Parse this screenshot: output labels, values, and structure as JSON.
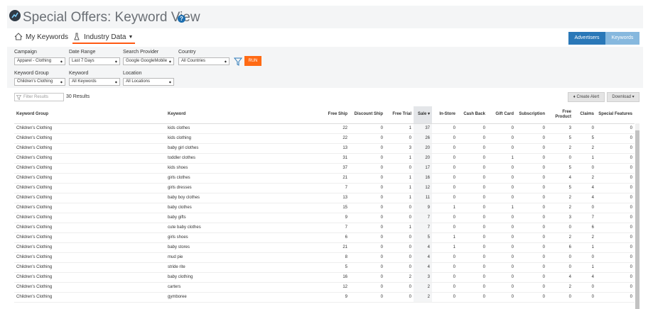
{
  "header": {
    "title": "Special Offers: Keyword View",
    "help": "?"
  },
  "nav": {
    "my_keywords": "My Keywords",
    "industry_data": "Industry Data"
  },
  "toggle": {
    "advertisers": "Advertisers",
    "keywords": "Keywords"
  },
  "colors": {
    "accent": "#ff6a14",
    "primary": "#2a78b8",
    "primary_light": "#86b8de",
    "help": "#1d6fb0"
  },
  "filters": {
    "campaign": {
      "label": "Campaign",
      "value": "Apparel - Clothing"
    },
    "date_range": {
      "label": "Date Range",
      "value": "Last 7 Days"
    },
    "search_provider": {
      "label": "Search Provider",
      "value": "Google GoogleMobile"
    },
    "country": {
      "label": "Country",
      "value": "All Countries"
    },
    "keyword_group": {
      "label": "Keyword Group",
      "value": "Children's Clothing"
    },
    "keyword": {
      "label": "Keyword",
      "value": "All Keywords"
    },
    "location": {
      "label": "Location",
      "value": "All Locations"
    },
    "run": "RUN"
  },
  "toolbar": {
    "filter_placeholder": "Filter Results",
    "results_count": "30 Results",
    "create_alert": "Create Alert",
    "download": "Download"
  },
  "table": {
    "columns": [
      "Keyword Group",
      "Keyword",
      "Free Ship",
      "Discount Ship",
      "Free Trial",
      "Sale",
      "In-Store",
      "Cash Back",
      "Gift Card",
      "Subscription",
      "Free Product",
      "Claims",
      "Special Features"
    ],
    "rows": [
      [
        "Children's Clothing",
        "kids clothes",
        "22",
        "0",
        "1",
        "37",
        "0",
        "0",
        "0",
        "0",
        "3",
        "0",
        "0"
      ],
      [
        "Children's Clothing",
        "kids clothing",
        "22",
        "0",
        "0",
        "26",
        "0",
        "0",
        "0",
        "0",
        "5",
        "5",
        "0"
      ],
      [
        "Children's Clothing",
        "baby girl clothes",
        "13",
        "0",
        "3",
        "20",
        "0",
        "0",
        "0",
        "0",
        "2",
        "2",
        "0"
      ],
      [
        "Children's Clothing",
        "toddler clothes",
        "31",
        "0",
        "1",
        "20",
        "0",
        "0",
        "1",
        "0",
        "0",
        "1",
        "0"
      ],
      [
        "Children's Clothing",
        "kids shoes",
        "37",
        "0",
        "0",
        "17",
        "0",
        "0",
        "0",
        "0",
        "5",
        "0",
        "0"
      ],
      [
        "Children's Clothing",
        "girls clothes",
        "21",
        "0",
        "1",
        "16",
        "0",
        "0",
        "0",
        "0",
        "4",
        "2",
        "0"
      ],
      [
        "Children's Clothing",
        "girls dresses",
        "7",
        "0",
        "1",
        "12",
        "0",
        "0",
        "0",
        "0",
        "5",
        "4",
        "0"
      ],
      [
        "Children's Clothing",
        "baby boy clothes",
        "13",
        "0",
        "1",
        "11",
        "0",
        "0",
        "0",
        "0",
        "2",
        "4",
        "0"
      ],
      [
        "Children's Clothing",
        "baby clothes",
        "15",
        "0",
        "0",
        "9",
        "1",
        "0",
        "1",
        "0",
        "2",
        "0",
        "0"
      ],
      [
        "Children's Clothing",
        "baby gifts",
        "9",
        "0",
        "0",
        "7",
        "0",
        "0",
        "0",
        "0",
        "3",
        "7",
        "0"
      ],
      [
        "Children's Clothing",
        "cute baby clothes",
        "7",
        "0",
        "1",
        "7",
        "0",
        "0",
        "0",
        "0",
        "0",
        "6",
        "0"
      ],
      [
        "Children's Clothing",
        "girls shoes",
        "6",
        "0",
        "0",
        "5",
        "1",
        "0",
        "0",
        "0",
        "2",
        "2",
        "0"
      ],
      [
        "Children's Clothing",
        "baby stores",
        "21",
        "0",
        "0",
        "4",
        "1",
        "0",
        "0",
        "0",
        "6",
        "1",
        "0"
      ],
      [
        "Children's Clothing",
        "mud pie",
        "8",
        "0",
        "0",
        "4",
        "0",
        "0",
        "0",
        "0",
        "0",
        "0",
        "0"
      ],
      [
        "Children's Clothing",
        "stride rite",
        "5",
        "0",
        "0",
        "4",
        "0",
        "0",
        "0",
        "0",
        "0",
        "1",
        "0"
      ],
      [
        "Children's Clothing",
        "baby clothing",
        "16",
        "0",
        "2",
        "3",
        "0",
        "0",
        "0",
        "0",
        "4",
        "4",
        "0"
      ],
      [
        "Children's Clothing",
        "carters",
        "12",
        "0",
        "0",
        "2",
        "0",
        "0",
        "0",
        "0",
        "2",
        "0",
        "0"
      ],
      [
        "Children's Clothing",
        "gymboree",
        "9",
        "0",
        "0",
        "2",
        "0",
        "0",
        "0",
        "0",
        "0",
        "0",
        "0"
      ]
    ]
  }
}
